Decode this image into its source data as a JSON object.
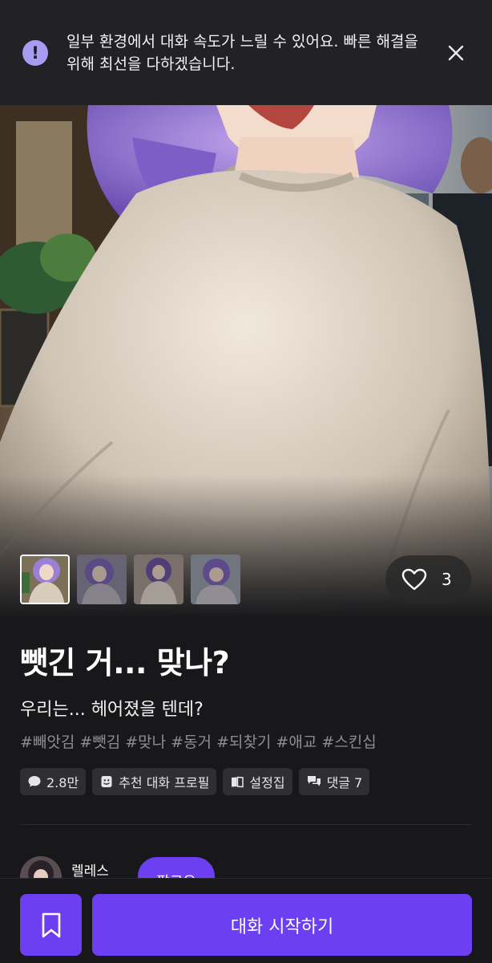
{
  "notice": {
    "icon": "exclamation-icon",
    "text": "일부 환경에서 대화 속도가 느릴 수 있어요. 빠른 해결을 위해 최선을 다하겠습니다.",
    "close_icon": "close-icon"
  },
  "hero": {
    "like_icon": "heart-icon",
    "like_count": "3"
  },
  "gallery": {
    "thumbnail_count": 4,
    "selected_index": 0
  },
  "character": {
    "title": "뺏긴 거... 맞나?",
    "subtitle": "우리는... 헤어졌을 텐데?",
    "tags": [
      "#빼앗김",
      "#뺏김",
      "#맞나",
      "#동거",
      "#되찾기",
      "#애교",
      "#스킨십"
    ]
  },
  "stats": {
    "chat_count": "2.8만",
    "recommended_profile": "추천 대화 프로필",
    "settings": "설정집",
    "comments": "댓글 7"
  },
  "author": {
    "name": "렐레스",
    "follow_label": "팔로우"
  },
  "actions": {
    "bookmark_icon": "bookmark-icon",
    "start_label": "대화 시작하기"
  },
  "colors": {
    "background": "#18181b",
    "banner": "#222226",
    "accent": "#6c3ff2",
    "notice_icon": "#a89cf2",
    "tag_text": "#8d8d93",
    "chip": "#2e2e33"
  }
}
